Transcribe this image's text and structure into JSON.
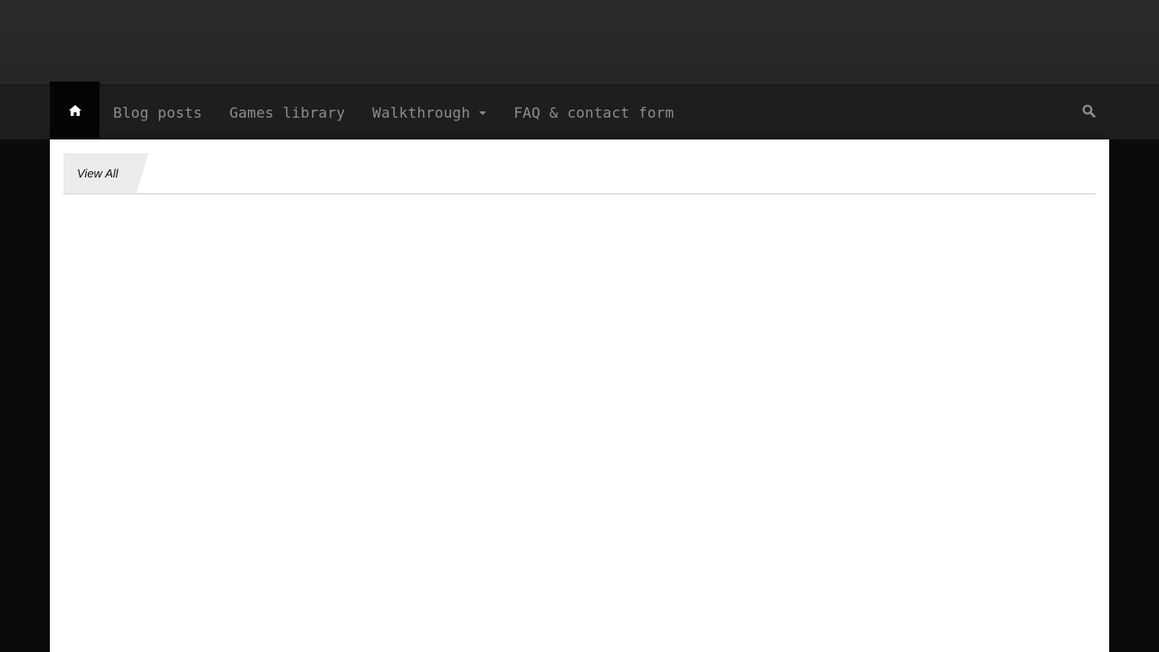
{
  "colors": {
    "header_top": "#2a2a2a",
    "nav_bar": "#1e1e1e",
    "home_active": "#050505",
    "menu_text": "#8c8c8c",
    "page_background": "#0b0b0b",
    "content_background": "#ffffff",
    "tab_background": "#ececec"
  },
  "nav": {
    "home_icon": "home-icon",
    "items": [
      {
        "label": "Blog posts"
      },
      {
        "label": "Games library"
      },
      {
        "label": "Walkthrough",
        "has_dropdown": true
      },
      {
        "label": "FAQ & contact form"
      }
    ],
    "search_icon": "search-icon"
  },
  "content": {
    "tab_label": "View All"
  }
}
